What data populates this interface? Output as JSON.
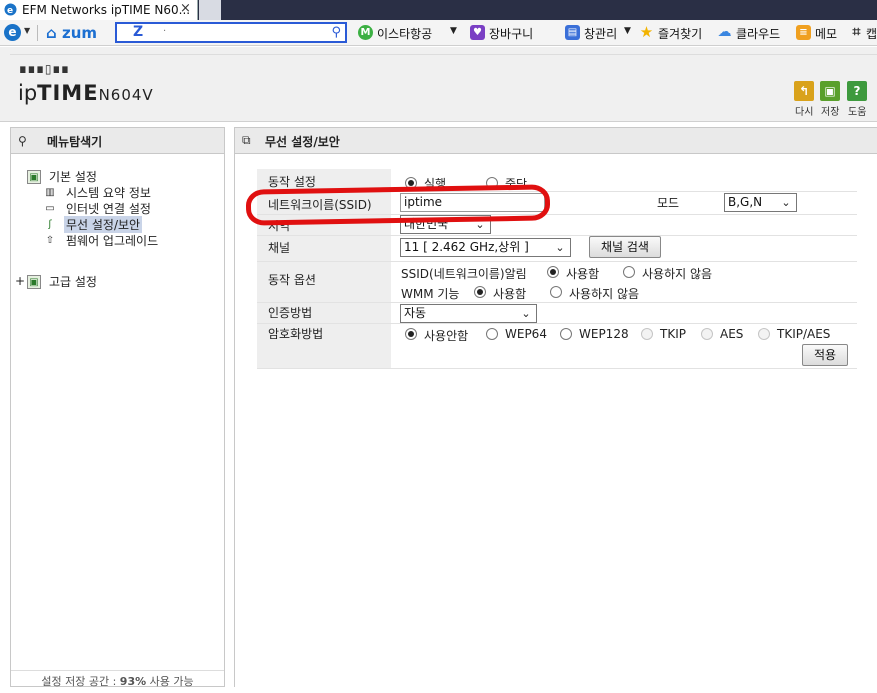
{
  "browser": {
    "tab_title": "EFM Networks ipTIME N60...",
    "tab_close": "×",
    "toolbar": {
      "zum_label": "zum",
      "search_logo": "Z",
      "search_value": "·",
      "items": [
        {
          "icon": "eastar-icon",
          "label": "이스타항공"
        },
        {
          "icon": "cart-icon",
          "label": "장바구니"
        },
        {
          "icon": "window-icon",
          "label": "창관리"
        },
        {
          "icon": "star-icon",
          "label": "즐겨찾기"
        },
        {
          "icon": "cloud-icon",
          "label": "클라우드"
        },
        {
          "icon": "memo-icon",
          "label": "메모"
        },
        {
          "icon": "crop-icon",
          "label": "캡"
        }
      ]
    }
  },
  "header": {
    "logo_dots": "∎∎∎▯∎∎",
    "logo_ip": "ip",
    "logo_time": "TIME",
    "logo_model": "N604V",
    "buttons": [
      {
        "name": "reload",
        "label": "다시",
        "color": "#d9a21b",
        "glyph": "↰"
      },
      {
        "name": "save",
        "label": "저장",
        "color": "#5aa02c",
        "glyph": "▣"
      },
      {
        "name": "help",
        "label": "도움",
        "color": "#3e9a3e",
        "glyph": "?"
      }
    ]
  },
  "left_menu": {
    "title": "메뉴탐색기",
    "group_basic": "기본 설정",
    "items": [
      "시스템 요약 정보",
      "인터넷 연결 설정",
      "무선 설정/보안",
      "펌웨어 업그레이드"
    ],
    "selected_index": 2,
    "group_advanced": "고급 설정",
    "expand_glyph": "+",
    "footer_prefix": "설정 저장 공간 : ",
    "footer_percent": "93%",
    "footer_suffix": " 사용 가능"
  },
  "panel": {
    "title": "무선 설정/보안",
    "operation": {
      "label": "동작 설정",
      "options": [
        "실행",
        "중단"
      ],
      "selected": 0
    },
    "ssid": {
      "label": "네트워크이름(SSID)",
      "value": "iptime"
    },
    "mode": {
      "label": "모드",
      "value": "B,G,N"
    },
    "region": {
      "label": "지역",
      "value": "대한민국"
    },
    "channel": {
      "label": "채널",
      "value": "11 [ 2.462 GHz,상위 ]",
      "scan_button": "채널 검색"
    },
    "options": {
      "label": "동작 옵션",
      "ssid_broadcast": {
        "label": "SSID(네트워크이름)알림",
        "choices": [
          "사용함",
          "사용하지 않음"
        ],
        "selected": 0
      },
      "wmm": {
        "label": "WMM 기능",
        "choices": [
          "사용함",
          "사용하지 않음"
        ],
        "selected": 0
      }
    },
    "auth": {
      "label": "인증방법",
      "value": "자동"
    },
    "encryption": {
      "label": "암호화방법",
      "choices": [
        "사용안함",
        "WEP64",
        "WEP128",
        "TKIP",
        "AES",
        "TKIP/AES"
      ],
      "selected": 0,
      "disabled": [
        3,
        4,
        5
      ]
    },
    "apply_button": "적용"
  },
  "colors": {
    "annotation": "#e01010",
    "selected_menu": "#c9d4e8"
  }
}
